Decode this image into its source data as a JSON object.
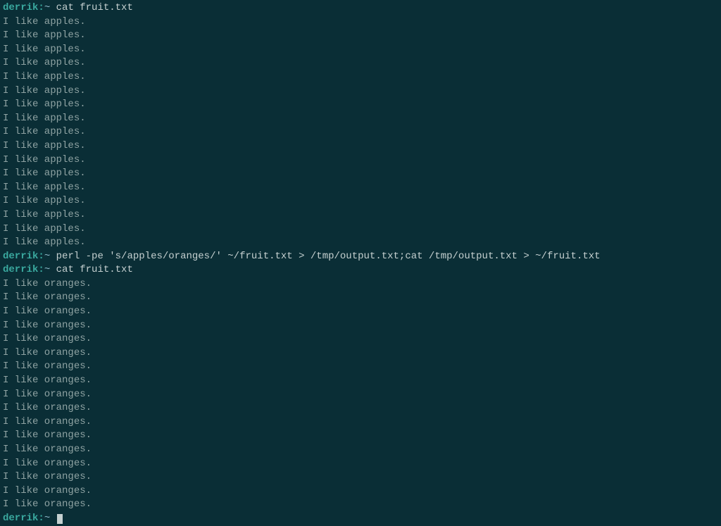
{
  "terminal": {
    "lines": [
      {
        "type": "prompt",
        "user": "derrik",
        "sep": ":",
        "path": "~",
        "cmd": "cat fruit.txt"
      },
      {
        "type": "output",
        "text": "I like apples."
      },
      {
        "type": "output",
        "text": "I like apples."
      },
      {
        "type": "output",
        "text": "I like apples."
      },
      {
        "type": "output",
        "text": "I like apples."
      },
      {
        "type": "output",
        "text": "I like apples."
      },
      {
        "type": "output",
        "text": "I like apples."
      },
      {
        "type": "output",
        "text": "I like apples."
      },
      {
        "type": "output",
        "text": "I like apples."
      },
      {
        "type": "output",
        "text": "I like apples."
      },
      {
        "type": "output",
        "text": "I like apples."
      },
      {
        "type": "output",
        "text": "I like apples."
      },
      {
        "type": "output",
        "text": "I like apples."
      },
      {
        "type": "output",
        "text": "I like apples."
      },
      {
        "type": "output",
        "text": "I like apples."
      },
      {
        "type": "output",
        "text": "I like apples."
      },
      {
        "type": "output",
        "text": "I like apples."
      },
      {
        "type": "output",
        "text": "I like apples."
      },
      {
        "type": "prompt",
        "user": "derrik",
        "sep": ":",
        "path": "~",
        "cmd": "perl -pe 's/apples/oranges/' ~/fruit.txt > /tmp/output.txt;cat /tmp/output.txt > ~/fruit.txt"
      },
      {
        "type": "prompt",
        "user": "derrik",
        "sep": ":",
        "path": "~",
        "cmd": "cat fruit.txt"
      },
      {
        "type": "output",
        "text": "I like oranges."
      },
      {
        "type": "output",
        "text": "I like oranges."
      },
      {
        "type": "output",
        "text": "I like oranges."
      },
      {
        "type": "output",
        "text": "I like oranges."
      },
      {
        "type": "output",
        "text": "I like oranges."
      },
      {
        "type": "output",
        "text": "I like oranges."
      },
      {
        "type": "output",
        "text": "I like oranges."
      },
      {
        "type": "output",
        "text": "I like oranges."
      },
      {
        "type": "output",
        "text": "I like oranges."
      },
      {
        "type": "output",
        "text": "I like oranges."
      },
      {
        "type": "output",
        "text": "I like oranges."
      },
      {
        "type": "output",
        "text": "I like oranges."
      },
      {
        "type": "output",
        "text": "I like oranges."
      },
      {
        "type": "output",
        "text": "I like oranges."
      },
      {
        "type": "output",
        "text": "I like oranges."
      },
      {
        "type": "output",
        "text": "I like oranges."
      },
      {
        "type": "output",
        "text": "I like oranges."
      },
      {
        "type": "prompt",
        "user": "derrik",
        "sep": ":",
        "path": "~",
        "cmd": "",
        "cursor": true
      }
    ]
  }
}
